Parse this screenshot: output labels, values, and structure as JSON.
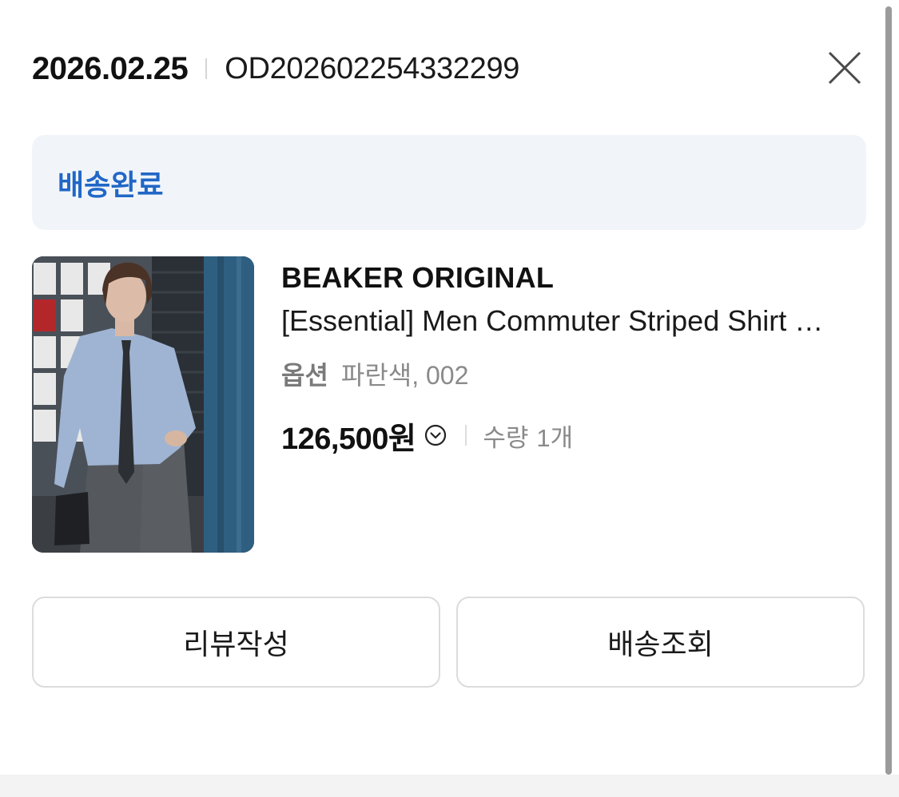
{
  "order": {
    "date": "2026.02.25",
    "number": "OD202602254332299"
  },
  "status": {
    "label": "배송완료",
    "color": "#2167c7"
  },
  "product": {
    "brand": "BEAKER ORIGINAL",
    "name": "[Essential] Men Commuter Striped Shirt - Blue",
    "option_label": "옵션",
    "option_value": "파란색, 002",
    "price": "126,500원",
    "quantity_label": "수량",
    "quantity_value": "1개",
    "image_description_icon": "product-photo"
  },
  "actions": {
    "review_label": "리뷰작성",
    "track_label": "배송조회"
  },
  "icons": {
    "close": "close-icon",
    "price_toggle": "chevron-down-circle-icon"
  }
}
